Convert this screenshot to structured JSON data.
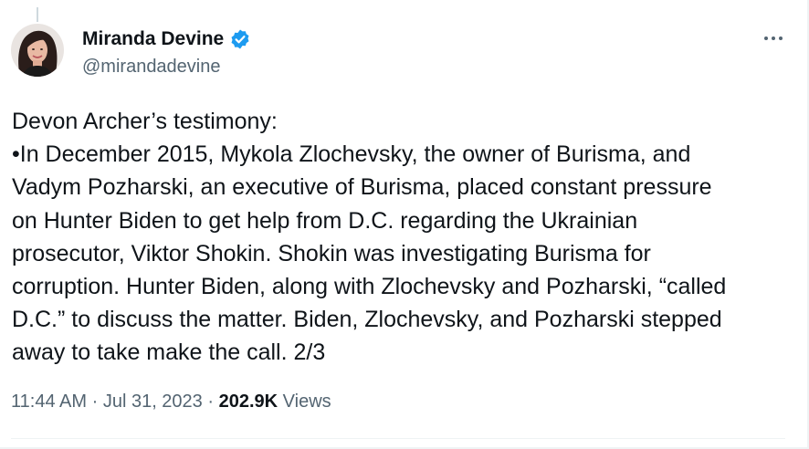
{
  "author": {
    "display_name": "Miranda Devine",
    "handle": "@mirandadevine",
    "verified": true
  },
  "tweet": {
    "lines": [
      "Devon Archer’s testimony:",
      "•In December 2015, Mykola Zlochevsky, the owner of Burisma, and",
      "Vadym Pozharski, an executive of Burisma, placed constant pressure",
      "on Hunter Biden to get help from D.C. regarding the Ukrainian",
      "prosecutor, Viktor Shokin. Shokin was investigating Burisma for",
      "corruption. Hunter Biden, along with Zlochevsky and Pozharski, “called",
      "D.C.” to discuss the matter. Biden, Zlochevsky, and Pozharski stepped",
      "away to take make the call. 2/3"
    ]
  },
  "meta": {
    "time": "11:44 AM",
    "separator": "·",
    "date": "Jul 31, 2023",
    "views_count": "202.9K",
    "views_label": "Views"
  },
  "icons": {
    "verified": "verified-badge-icon",
    "more": "more-options-icon"
  },
  "colors": {
    "verified_blue": "#1d9bf0",
    "text_primary": "#0f1419",
    "text_secondary": "#536471",
    "divider": "#eff3f4"
  }
}
